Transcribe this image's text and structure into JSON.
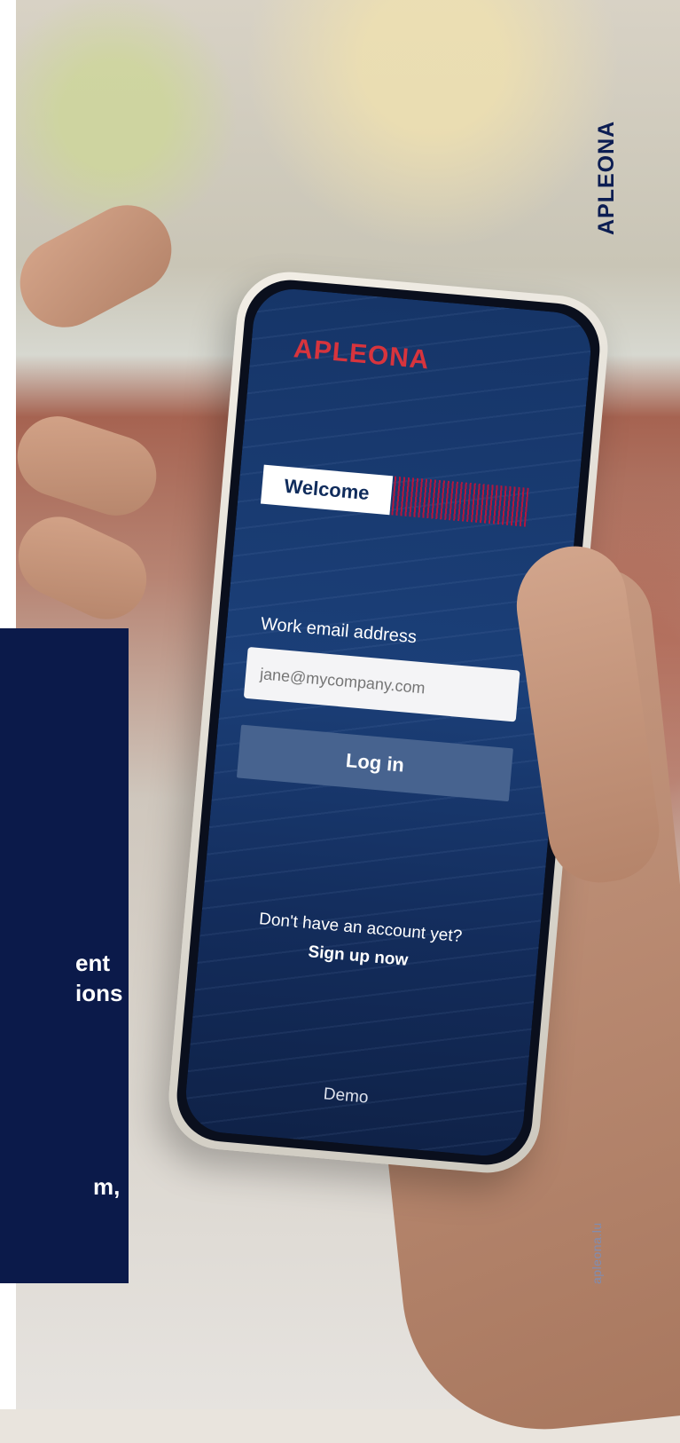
{
  "brand": {
    "vertical_logo": "APLEONA",
    "site_url": "apleona.lu",
    "colors": {
      "navy": "#0b1a4a",
      "brand_red": "#d7343d",
      "button_blue": "#47638f"
    }
  },
  "phone_screen": {
    "logo": "APLEONA",
    "welcome": "Welcome",
    "email_label": "Work email address",
    "email_placeholder": "jane@mycompany.com",
    "email_value": "",
    "login_button": "Log in",
    "no_account_text": "Don't have an account yet?",
    "signup_link": "Sign up now",
    "demo_link": "Demo"
  },
  "panel": {
    "lines": [
      "ent",
      "ions",
      "m,"
    ]
  }
}
